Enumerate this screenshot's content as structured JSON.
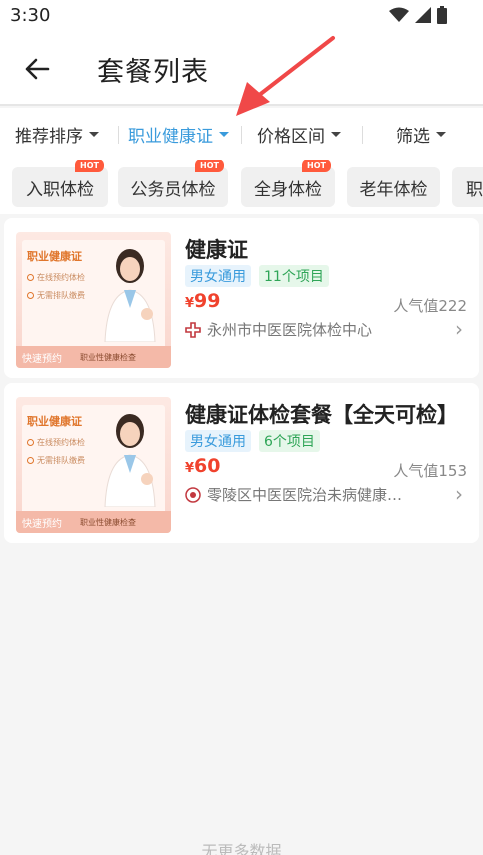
{
  "status": {
    "time": "3:30"
  },
  "header": {
    "title": "套餐列表"
  },
  "filters": {
    "sort": "推荐排序",
    "category": "职业健康证",
    "price": "价格区间",
    "screen": "筛选"
  },
  "tags": [
    {
      "label": "入职体检",
      "hot": "HOT"
    },
    {
      "label": "公务员体检",
      "hot": "HOT"
    },
    {
      "label": "全身体检",
      "hot": "HOT"
    },
    {
      "label": "老年体检"
    },
    {
      "label": "职"
    }
  ],
  "packages": [
    {
      "name": "健康证",
      "gender": "男女通用",
      "items": "11个项目",
      "currency": "¥",
      "price": "99",
      "popularity": "人气值222",
      "hospital": "永州市中医医院体检中心",
      "thumb": {
        "title": "职业健康证",
        "line1": "在线预约体检",
        "line2": "无需排队缴费",
        "button": "快速预约",
        "footer": "职业性健康检查"
      }
    },
    {
      "name": "健康证体检套餐【全天可检】",
      "gender": "男女通用",
      "items": "6个项目",
      "currency": "¥",
      "price": "60",
      "popularity": "人气值153",
      "hospital": "零陵区中医医院治未病健康…",
      "thumb": {
        "title": "职业健康证",
        "line1": "在线预约体检",
        "line2": "无需排队缴费",
        "button": "快速预约",
        "footer": "职业性健康检查"
      }
    }
  ],
  "footer": {
    "no_more": "无更多数据"
  },
  "colors": {
    "accent": "#3a9bdc",
    "price": "#f0422d",
    "hot": "#ff5a3c",
    "annotation_arrow": "#f04848"
  }
}
